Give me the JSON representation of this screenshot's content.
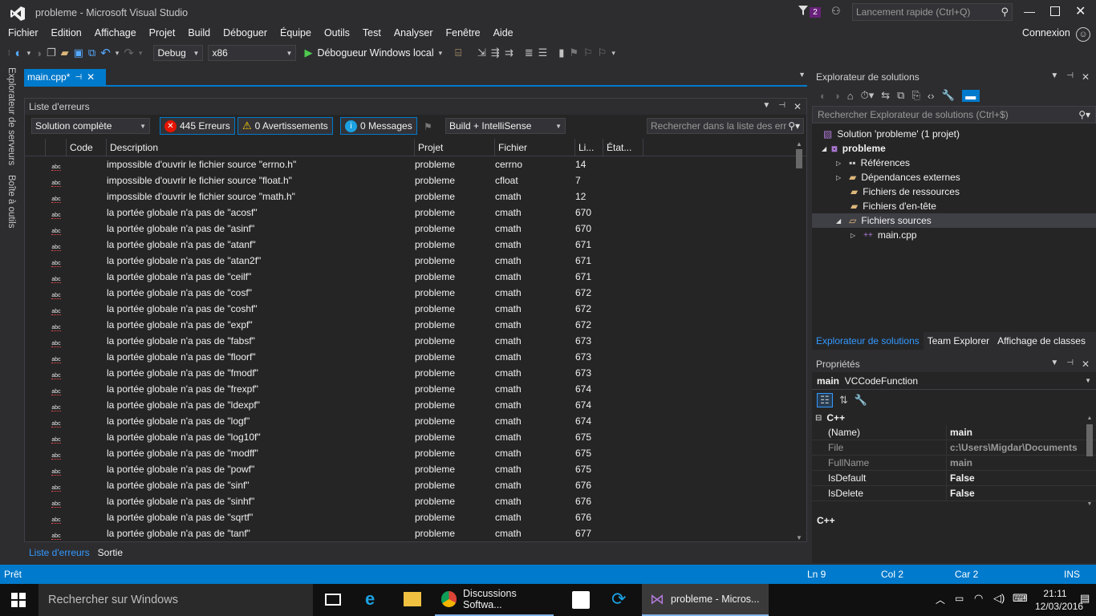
{
  "window": {
    "title": "probleme - Microsoft Visual Studio",
    "notif_count": "2",
    "quick_launch_placeholder": "Lancement rapide (Ctrl+Q)",
    "connexion": "Connexion"
  },
  "menu": [
    "Fichier",
    "Edition",
    "Affichage",
    "Projet",
    "Build",
    "Déboguer",
    "Équipe",
    "Outils",
    "Test",
    "Analyser",
    "Fenêtre",
    "Aide"
  ],
  "toolbar": {
    "config": "Debug",
    "platform": "x86",
    "debugger": "Débogueur Windows local"
  },
  "left_rail": {
    "server_explorer": "Explorateur de serveurs",
    "toolbox": "Boîte à outils"
  },
  "editor": {
    "tab": "main.cpp*",
    "tab_pin": "⊣"
  },
  "error_list": {
    "title": "Liste d'erreurs",
    "scope": "Solution complète",
    "errors": "445 Erreurs",
    "warnings": "0 Avertissements",
    "messages": "0 Messages",
    "source": "Build + IntelliSense",
    "search_placeholder": "Rechercher dans la liste des err",
    "columns": [
      "Code",
      "Description",
      "Projet",
      "Fichier",
      "Li...",
      "État..."
    ],
    "rows": [
      {
        "desc": "impossible d'ouvrir le fichier source \"errno.h\"",
        "project": "probleme",
        "file": "cerrno",
        "line": "14"
      },
      {
        "desc": "impossible d'ouvrir le fichier source \"float.h\"",
        "project": "probleme",
        "file": "cfloat",
        "line": "7"
      },
      {
        "desc": "impossible d'ouvrir le fichier source \"math.h\"",
        "project": "probleme",
        "file": "cmath",
        "line": "12"
      },
      {
        "desc": "la portée globale n'a pas de \"acosf\"",
        "project": "probleme",
        "file": "cmath",
        "line": "670"
      },
      {
        "desc": "la portée globale n'a pas de \"asinf\"",
        "project": "probleme",
        "file": "cmath",
        "line": "670"
      },
      {
        "desc": "la portée globale n'a pas de \"atanf\"",
        "project": "probleme",
        "file": "cmath",
        "line": "671"
      },
      {
        "desc": "la portée globale n'a pas de \"atan2f\"",
        "project": "probleme",
        "file": "cmath",
        "line": "671"
      },
      {
        "desc": "la portée globale n'a pas de \"ceilf\"",
        "project": "probleme",
        "file": "cmath",
        "line": "671"
      },
      {
        "desc": "la portée globale n'a pas de \"cosf\"",
        "project": "probleme",
        "file": "cmath",
        "line": "672"
      },
      {
        "desc": "la portée globale n'a pas de \"coshf\"",
        "project": "probleme",
        "file": "cmath",
        "line": "672"
      },
      {
        "desc": "la portée globale n'a pas de \"expf\"",
        "project": "probleme",
        "file": "cmath",
        "line": "672"
      },
      {
        "desc": "la portée globale n'a pas de \"fabsf\"",
        "project": "probleme",
        "file": "cmath",
        "line": "673"
      },
      {
        "desc": "la portée globale n'a pas de \"floorf\"",
        "project": "probleme",
        "file": "cmath",
        "line": "673"
      },
      {
        "desc": "la portée globale n'a pas de \"fmodf\"",
        "project": "probleme",
        "file": "cmath",
        "line": "673"
      },
      {
        "desc": "la portée globale n'a pas de \"frexpf\"",
        "project": "probleme",
        "file": "cmath",
        "line": "674"
      },
      {
        "desc": "la portée globale n'a pas de \"ldexpf\"",
        "project": "probleme",
        "file": "cmath",
        "line": "674"
      },
      {
        "desc": "la portée globale n'a pas de \"logf\"",
        "project": "probleme",
        "file": "cmath",
        "line": "674"
      },
      {
        "desc": "la portée globale n'a pas de \"log10f\"",
        "project": "probleme",
        "file": "cmath",
        "line": "675"
      },
      {
        "desc": "la portée globale n'a pas de \"modff\"",
        "project": "probleme",
        "file": "cmath",
        "line": "675"
      },
      {
        "desc": "la portée globale n'a pas de \"powf\"",
        "project": "probleme",
        "file": "cmath",
        "line": "675"
      },
      {
        "desc": "la portée globale n'a pas de \"sinf\"",
        "project": "probleme",
        "file": "cmath",
        "line": "676"
      },
      {
        "desc": "la portée globale n'a pas de \"sinhf\"",
        "project": "probleme",
        "file": "cmath",
        "line": "676"
      },
      {
        "desc": "la portée globale n'a pas de \"sqrtf\"",
        "project": "probleme",
        "file": "cmath",
        "line": "676"
      },
      {
        "desc": "la portée globale n'a pas de \"tanf\"",
        "project": "probleme",
        "file": "cmath",
        "line": "677"
      }
    ],
    "bottom_tabs": [
      "Liste d'erreurs",
      "Sortie"
    ]
  },
  "solution_explorer": {
    "title": "Explorateur de solutions",
    "search_placeholder": "Rechercher Explorateur de solutions (Ctrl+$)",
    "solution": "Solution 'probleme' (1 projet)",
    "project": "probleme",
    "items": [
      "Références",
      "Dépendances externes",
      "Fichiers de ressources",
      "Fichiers d'en-tête",
      "Fichiers sources"
    ],
    "file": "main.cpp",
    "tabs": [
      "Explorateur de solutions",
      "Team Explorer",
      "Affichage de classes"
    ]
  },
  "properties": {
    "title": "Propriétés",
    "object_name": "main",
    "object_type": "VCCodeFunction",
    "category": "C++",
    "rows": [
      {
        "name": "(Name)",
        "value": "main"
      },
      {
        "name": "File",
        "value": "c:\\Users\\Migdar\\Documents"
      },
      {
        "name": "FullName",
        "value": "main"
      },
      {
        "name": "IsDefault",
        "value": "False"
      },
      {
        "name": "IsDelete",
        "value": "False"
      }
    ],
    "description": "C++"
  },
  "status": {
    "ready": "Prêt",
    "ln": "Ln 9",
    "col": "Col 2",
    "car": "Car 2",
    "ins": "INS"
  },
  "taskbar": {
    "search": "Rechercher sur Windows",
    "chrome_app": "Discussions Softwa...",
    "vs_app": "probleme - Micros...",
    "time": "21:11",
    "date": "12/03/2016"
  },
  "colors": {
    "accent": "#007acc",
    "error_red": "#e51400",
    "info_blue": "#1ba1e2",
    "vs_purple": "#68217a"
  }
}
